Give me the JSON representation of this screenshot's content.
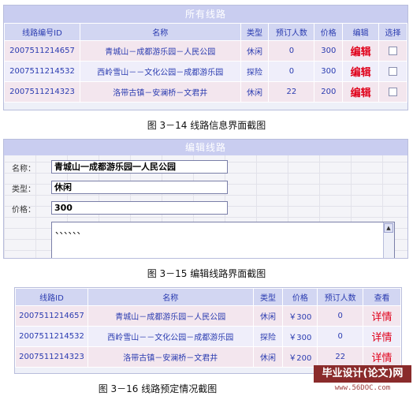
{
  "section1": {
    "title": "所有线路",
    "headers": [
      "线路编号ID",
      "名称",
      "类型",
      "预订人数",
      "价格",
      "编辑",
      "选择"
    ],
    "rows": [
      {
        "id": "2007511214657",
        "name": "青城山－成都游乐园－人民公园",
        "type": "休闲",
        "count": "0",
        "price": "300",
        "edit": "编辑"
      },
      {
        "id": "2007511214532",
        "name": "西岭雪山－－文化公园－成都游乐园",
        "type": "探险",
        "count": "0",
        "price": "300",
        "edit": "编辑"
      },
      {
        "id": "2007511214323",
        "name": "洛带古镇－安澜桥－文君井",
        "type": "休闲",
        "count": "22",
        "price": "200",
        "edit": "编辑"
      }
    ],
    "caption": "图 3－14   线路信息界面截图"
  },
  "section2": {
    "title": "编辑线路",
    "name_label": "名称：",
    "name_value": "青城山一成都游乐园一人民公园",
    "type_label": "类型：",
    "type_value": "休闲",
    "price_label": "价格：",
    "price_value": "300",
    "textarea_value": "、、、、、、",
    "caption": "图 3－15   编辑线路界面截图"
  },
  "section3": {
    "headers": [
      "线路ID",
      "名称",
      "类型",
      "价格",
      "预订人数",
      "查看"
    ],
    "rows": [
      {
        "id": "2007511214657",
        "name": "青城山－成都游乐园－人民公园",
        "type": "休闲",
        "price": "￥300",
        "count": "0",
        "view": "详情"
      },
      {
        "id": "2007511214532",
        "name": "西岭雪山－－文化公园－成都游乐园",
        "type": "探险",
        "price": "￥300",
        "count": "0",
        "view": "详情"
      },
      {
        "id": "2007511214323",
        "name": "洛带古镇－安澜桥－文君井",
        "type": "休闲",
        "price": "￥200",
        "count": "22",
        "view": "详情"
      }
    ],
    "caption": "图 3－16   线路预定情况截图"
  },
  "watermark": {
    "top": "毕业设计(论文)网",
    "bottom": "www.56DOC.com"
  }
}
